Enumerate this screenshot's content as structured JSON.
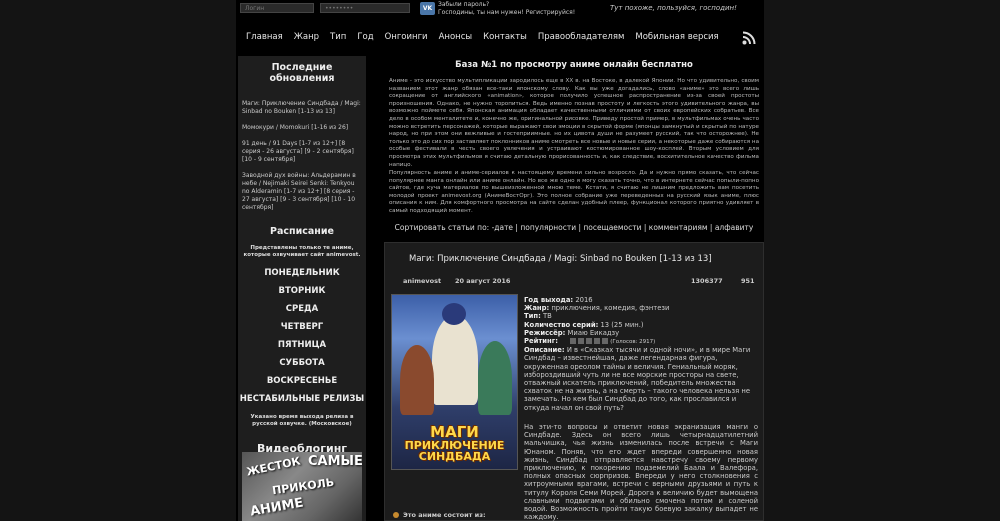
{
  "topbar": {
    "login_placeholder": "Логин",
    "password_placeholder": "••••••••",
    "vk_label": "VK",
    "forgot_password": "Забыли пароль?",
    "register_text": "Господины, ты нам нужен! Регистрируйся!",
    "tagline": "Тут похоже, пользуйся, господин!"
  },
  "nav": {
    "items": [
      "Главная",
      "Жанр",
      "Тип",
      "Год",
      "Онгоинги",
      "Анонсы",
      "Контакты",
      "Правообладателям",
      "Мобильная версия"
    ],
    "rss_icon": "rss-icon"
  },
  "sidebar": {
    "updates_title": "Последние обновления",
    "updates": [
      "Маги: Приключение Синдбада / Magi: Sinbad no Bouken [1-13 из 13]",
      "Момокури / Momokuri [1-16 из 26]",
      "91 день / 91 Days [1-7 из 12+] [8 серия - 26 августа] [9 - 2 сентября] [10 - 9 сентября]",
      "Заводной дух войны: Альдерамин в небе / Nejimaki Seirei Senki: Tenkyou no Alderamin [1-7 из 12+] [8 серия - 27 августа] [9 - 3 сентября] [10 - 10 сентября]"
    ],
    "schedule_title": "Расписание",
    "schedule_note": "Представлены только те аниме, которые озвучивает сайт animevost.",
    "days": [
      "ПОНЕДЕЛЬНИК",
      "ВТОРНИК",
      "СРЕДА",
      "ЧЕТВЕРГ",
      "ПЯТНИЦА",
      "СУББОТА",
      "ВОСКРЕСЕНЬЕ",
      "НЕСТАБИЛЬНЫЕ РЕЛИЗЫ"
    ],
    "release_note": "Указано время выхода релиза в русской озвучке. (Московское)",
    "vlog_title": "Видеоблогинг",
    "vlog_words": [
      "ЖЕСТОК",
      "САМЫЕ",
      "ПРИКОЛЬ",
      "АНИМЕ"
    ]
  },
  "main": {
    "title": "База №1 по просмотру аниме онлайн бесплатно",
    "para1": "Аниме - это искусство мультипликации зародилось еще в XX в. на Востоке, в далекой Японии. Но что удивительно, своим названием этот жанр обязан все-таки японскому слову. Как вы уже догадались, слово «аниме» это всего лишь сокращение от английского «animation», которое получило успешное распространение из-за своей простоты произношения. Однако, не нужно торопиться. Ведь именно познав простоту и легкость этого удивительного жанра, вы возможно поймете себя. Японская анимация обладает качественными отличиями от своих европейских собратьев. Все дело в особом менталитете и, конечно же, оригинальной рисовке. Приведу простой пример, в мультфильмах очень часто можно встретить персонажей, которые выражают свои эмоции в скрытой форме (японцы замкнутый и скрытый по натуре народ, но при этом они вежливые и гостеприимные. но их цивота души не разумеет русский, так что осторожнее). Не только это до сих пор заставляет поклонников аниме смотреть все новые и новые серии, а некоторые даже собираются на особые фестивали в честь своего увлечения и устраивают костюмированное шоу-косплей. Вторым условием для просмотра этих мультфильмов я считаю детальную прорисованность и, как следствие, восхитительное качество фильма напицо.",
    "para2": "Популярность аниме и аниме-сериалов к настоящему времени сильно возросло. Да и нужно прямо сказать, что сейчас популярнее манга онлайн или аниме онлайн. Но все же одно я могу сказать точно, что в интернете сейчас попыли-попно сайтов, где куча материалов по вышеизложенной мною теме. Кстати, я считаю не лишним предложить вам посетить молодой проект animevost.org (АнимеВостОрг). Это полное собрание уже переведенных на русский язык аниме, плюс описания к ним. Для комфортного просмотра на сайте сделан удобный плеер, функционал которого приятно удивляет в самый подходящий момент.",
    "sort_text": "Сортировать статьи по: -дате | популярности | посещаемости | комментариям | алфавиту"
  },
  "card": {
    "title": "Маги: Приключение Синдбада / Magi: Sinbad no Bouken [1-13 из 13]",
    "author": "animevost",
    "date": "20 август 2016",
    "views": "1306377",
    "comments": "951",
    "poster_title_line1": "МАГИ",
    "poster_title_line2": "ПРИКЛЮЧЕНИЕ СИНДБАДА",
    "year_label": "Год выхода:",
    "year": "2016",
    "genre_label": "Жанр:",
    "genre": "приключения, комедия, фэнтези",
    "type_label": "Тип:",
    "type": "ТВ",
    "episodes_label": "Количество серий:",
    "episodes": "13 (25 мин.)",
    "director_label": "Режиссёр:",
    "director": "Миаю Еикадзу",
    "rating_label": "Рейтинг:",
    "votes": "(Голосов: 2917)",
    "description_label": "Описание:",
    "description1": "И в «Сказках тысячи и одной ночи», и в мире Маги Синдбад – известнейшая, даже легендарная фигура, окруженная ореолом тайны и величия. Гениальный моряк, избороздивший чуть ли не все морские просторы на свете, отважный искатель приключений, победитель множества схваток не на жизнь, а на смерть – такого человека нельзя не замечать. Но кем был Синдбад до того, как прославился и откуда начал он свой путь?",
    "description2": "На эти-то вопросы и ответит новая экранизация манги о Синдбаде. Здесь он всего лишь четырнадцатилетний мальчишка, чья жизнь изменилась после встречи с Маги Юнаном. Поняв, что его ждет впереди совершенно новая жизнь, Синдбад отправляется навстречу своему первому приключению, к покорению подземелий Баала и Валефора, полных опасных сюрпризов. Впереди у него столкновения с хитроумными врагами, встречи с верными друзьями и путь к титулу Короля Семи Морей. Дорога к величию будет вымощена славными подвигами и обильно смочена потом и соленой водой. Возможность пройти такую боевую закалку выпадет не каждому.",
    "consists_label": "Это аниме состоит из:"
  }
}
